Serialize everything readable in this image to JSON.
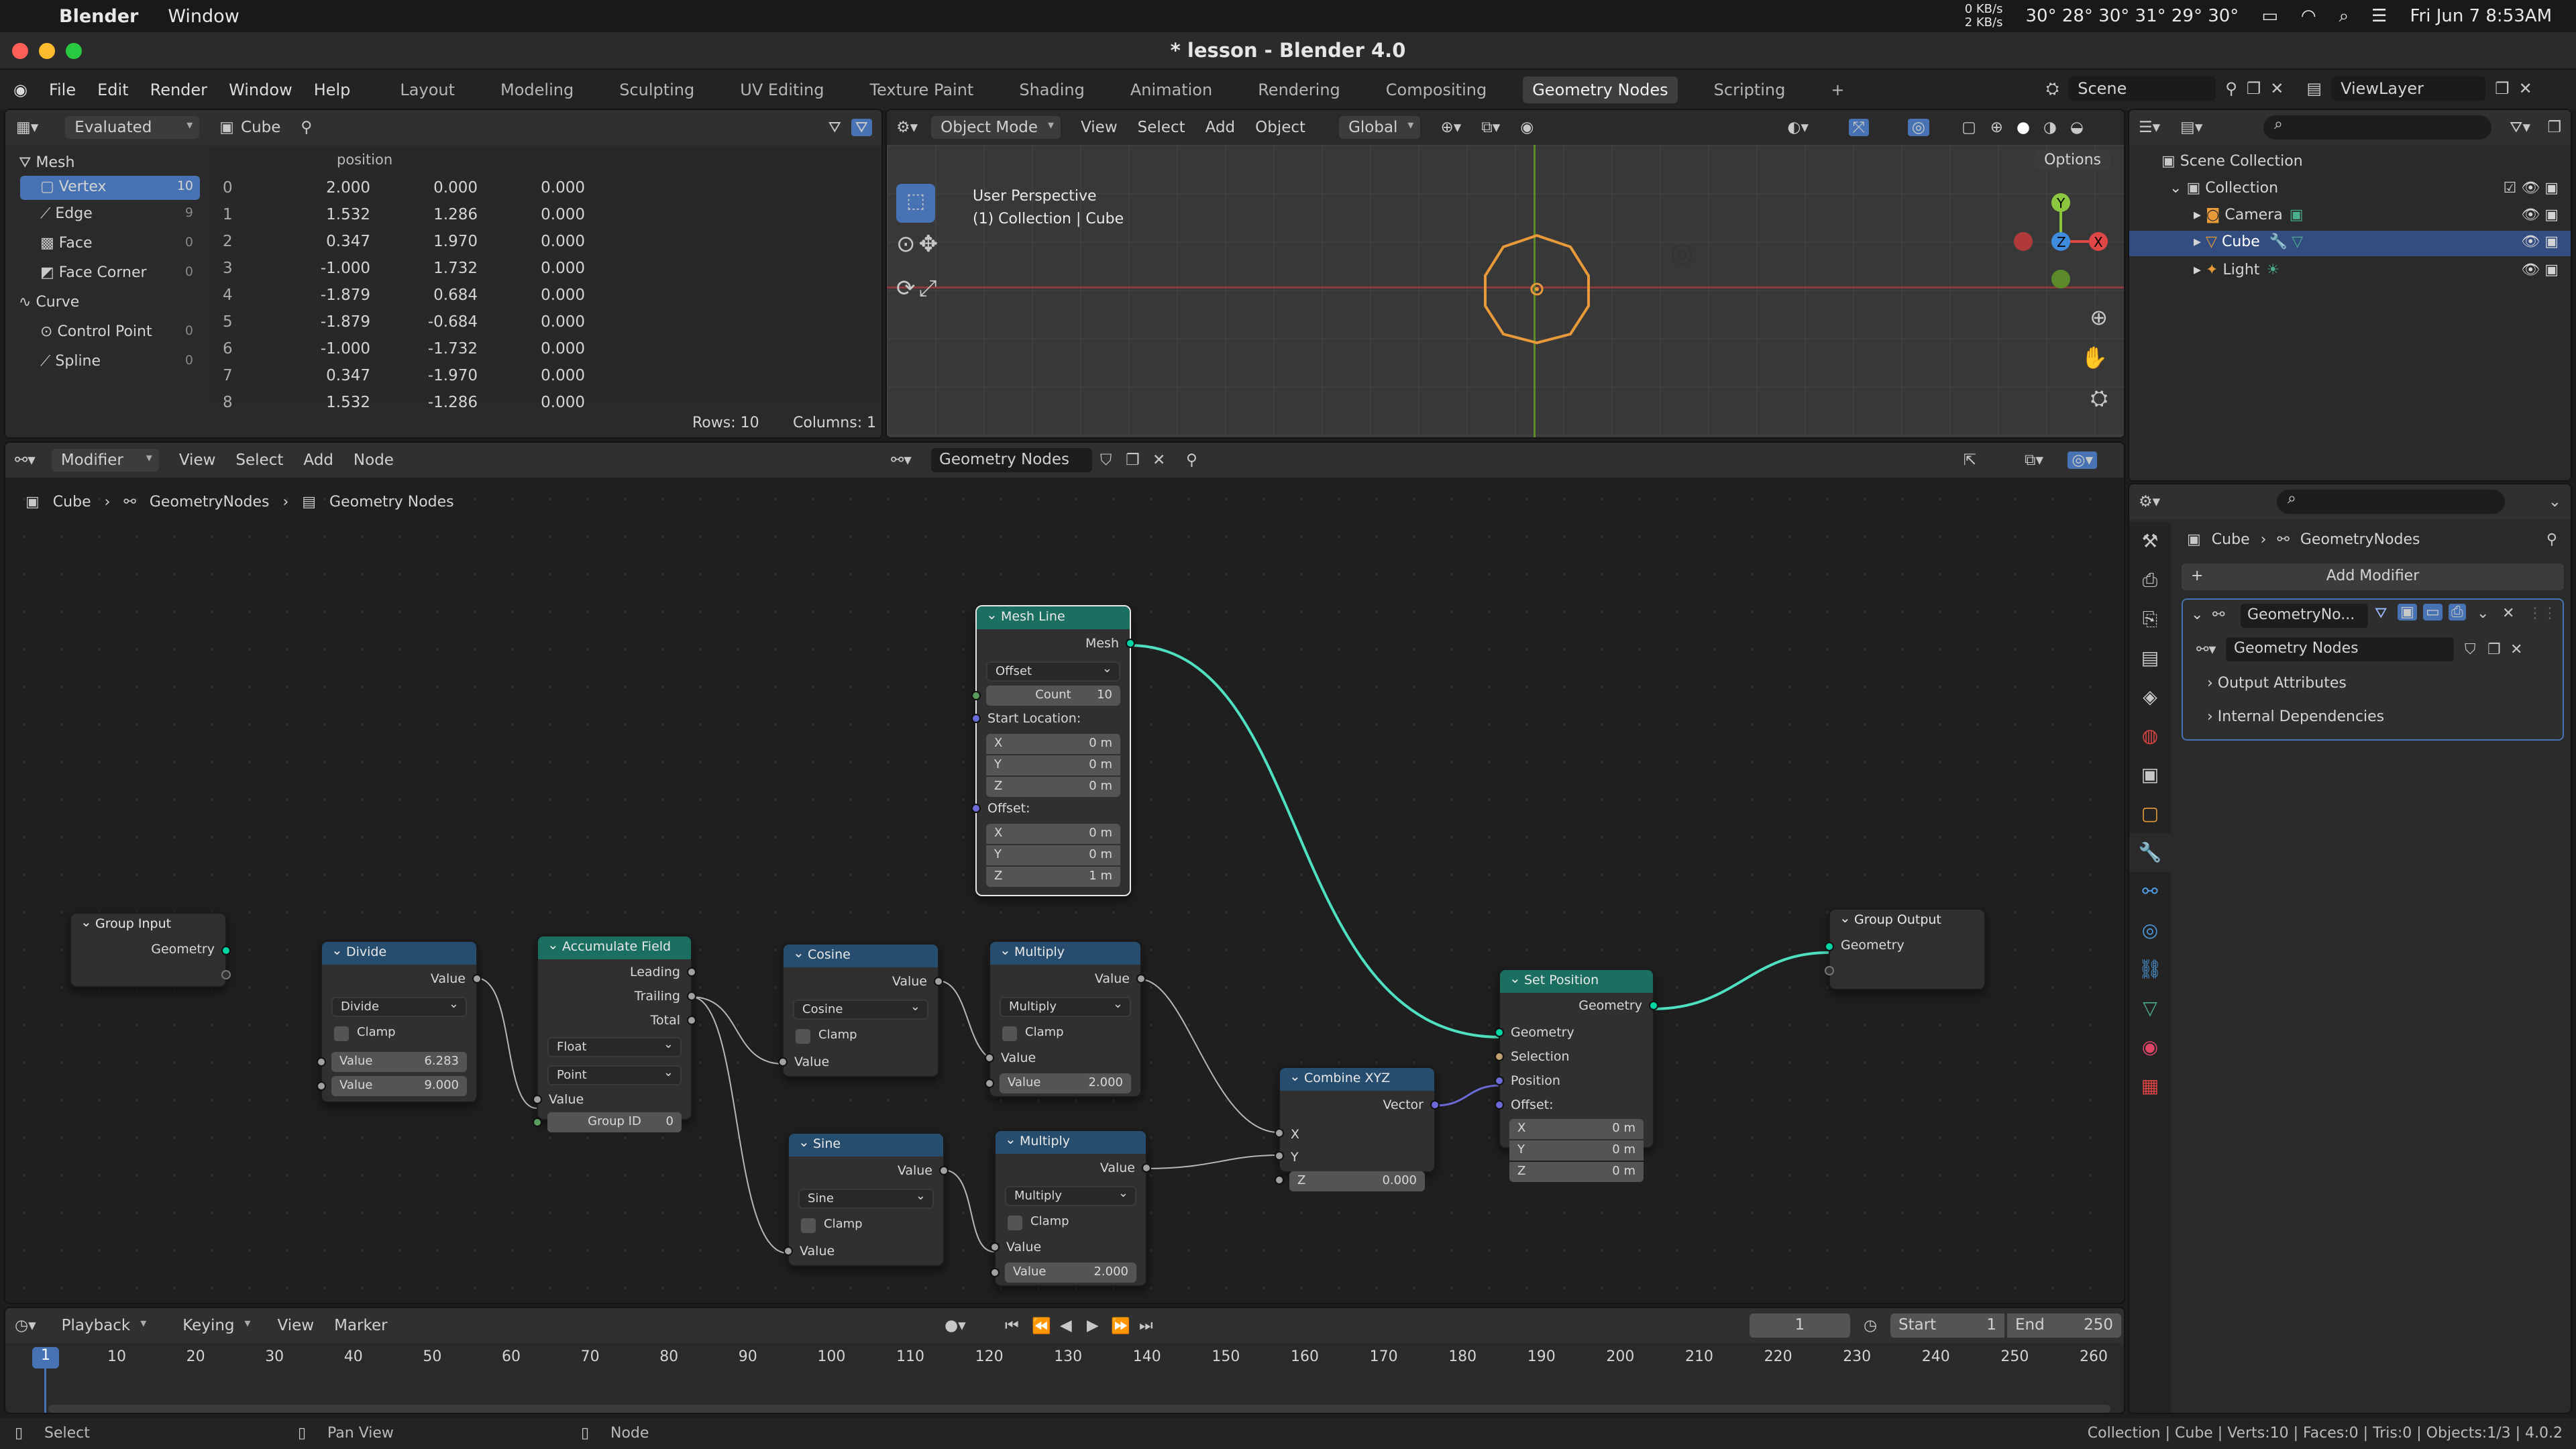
{
  "mac": {
    "app": "Blender",
    "window": "Window",
    "net_up": "0 KB/s",
    "net_down": "2 KB/s",
    "temps": "30° 28° 30° 31° 29° 30°",
    "datetime": "Fri Jun 7  8:53AM"
  },
  "title": "* lesson - Blender 4.0",
  "menus": [
    "File",
    "Edit",
    "Render",
    "Window",
    "Help"
  ],
  "workspaces": [
    "Layout",
    "Modeling",
    "Sculpting",
    "UV Editing",
    "Texture Paint",
    "Shading",
    "Animation",
    "Rendering",
    "Compositing",
    "Geometry Nodes",
    "Scripting"
  ],
  "active_workspace": "Geometry Nodes",
  "scene": "Scene",
  "view_layer": "ViewLayer",
  "spreadsheet": {
    "mode": "Evaluated",
    "object": "Cube",
    "column": "position",
    "tree": [
      {
        "label": "Mesh",
        "count": ""
      },
      {
        "label": "Vertex",
        "count": "10"
      },
      {
        "label": "Edge",
        "count": "9"
      },
      {
        "label": "Face",
        "count": "0"
      },
      {
        "label": "Face Corner",
        "count": "0"
      },
      {
        "label": "Curve",
        "count": ""
      },
      {
        "label": "Control Point",
        "count": "0"
      },
      {
        "label": "Spline",
        "count": "0"
      }
    ],
    "rows": [
      [
        "0",
        "2.000",
        "0.000",
        "0.000"
      ],
      [
        "1",
        "1.532",
        "1.286",
        "0.000"
      ],
      [
        "2",
        "0.347",
        "1.970",
        "0.000"
      ],
      [
        "3",
        "-1.000",
        "1.732",
        "0.000"
      ],
      [
        "4",
        "-1.879",
        "0.684",
        "0.000"
      ],
      [
        "5",
        "-1.879",
        "-0.684",
        "0.000"
      ],
      [
        "6",
        "-1.000",
        "-1.732",
        "0.000"
      ],
      [
        "7",
        "0.347",
        "-1.970",
        "0.000"
      ],
      [
        "8",
        "1.532",
        "-1.286",
        "0.000"
      ]
    ],
    "rows_label": "Rows: 10",
    "cols_label": "Columns: 1"
  },
  "viewport": {
    "mode": "Object Mode",
    "menus": [
      "View",
      "Select",
      "Add",
      "Object"
    ],
    "orient": "Global",
    "options": "Options",
    "persp": "User Perspective",
    "coll": "(1) Collection | Cube"
  },
  "outliner": {
    "items": [
      "Scene Collection",
      "Collection",
      "Camera",
      "Cube",
      "Light"
    ]
  },
  "node_editor": {
    "header": {
      "mode": "Modifier",
      "menus": [
        "View",
        "Select",
        "Add",
        "Node"
      ],
      "tree": "Geometry Nodes"
    },
    "breadcrumb": [
      "Cube",
      "GeometryNodes",
      "Geometry Nodes"
    ],
    "nodes": {
      "group_input": {
        "title": "Group Input",
        "out": "Geometry"
      },
      "divide": {
        "title": "Divide",
        "out": "Value",
        "op": "Divide",
        "clamp": "Clamp",
        "in_label": "Value",
        "v1": "6.283",
        "v2": "9.000"
      },
      "accum": {
        "title": "Accumulate Field",
        "o1": "Leading",
        "o2": "Trailing",
        "o3": "Total",
        "dtype": "Float",
        "domain": "Point",
        "in": "Value",
        "gid": "Group ID",
        "gid_v": "0"
      },
      "cosine": {
        "title": "Cosine",
        "out": "Value",
        "op": "Cosine",
        "clamp": "Clamp",
        "in": "Value"
      },
      "sine": {
        "title": "Sine",
        "out": "Value",
        "op": "Sine",
        "clamp": "Clamp",
        "in": "Value"
      },
      "mult1": {
        "title": "Multiply",
        "out": "Value",
        "op": "Multiply",
        "clamp": "Clamp",
        "in": "Value",
        "v": "2.000"
      },
      "mult2": {
        "title": "Multiply",
        "out": "Value",
        "op": "Multiply",
        "clamp": "Clamp",
        "in": "Value",
        "v": "2.000"
      },
      "meshline": {
        "title": "Mesh Line",
        "out": "Mesh",
        "mode": "Offset",
        "count_l": "Count",
        "count": "10",
        "start": "Start Location:",
        "offset": "Offset:",
        "sx": "0 m",
        "sy": "0 m",
        "sz": "0 m",
        "ox": "0 m",
        "oy": "0 m",
        "oz": "1 m"
      },
      "combine": {
        "title": "Combine XYZ",
        "out": "Vector",
        "x": "X",
        "y": "Y",
        "z": "Z",
        "zv": "0.000"
      },
      "setpos": {
        "title": "Set Position",
        "out": "Geometry",
        "i1": "Geometry",
        "i2": "Selection",
        "i3": "Position",
        "i4": "Offset:",
        "x": "0 m",
        "y": "0 m",
        "z": "0 m"
      },
      "group_output": {
        "title": "Group Output",
        "in": "Geometry"
      }
    }
  },
  "properties": {
    "breadcrumb": [
      "Cube",
      "GeometryNodes"
    ],
    "add_modifier": "Add Modifier",
    "mod_name": "GeometryNo...",
    "tree": "Geometry Nodes",
    "p1": "Output Attributes",
    "p2": "Internal Dependencies"
  },
  "timeline": {
    "menus": [
      "Playback",
      "Keying",
      "View",
      "Marker"
    ],
    "frame": "1",
    "start_l": "Start",
    "start": "1",
    "end_l": "End",
    "end": "250",
    "ticks": [
      "10",
      "20",
      "30",
      "40",
      "50",
      "60",
      "70",
      "80",
      "90",
      "100",
      "110",
      "120",
      "130",
      "140",
      "150",
      "160",
      "170",
      "180",
      "190",
      "200",
      "210",
      "220",
      "230",
      "240",
      "250",
      "260"
    ],
    "cur": "1"
  },
  "status": {
    "select": "Select",
    "pan": "Pan View",
    "node": "Node",
    "info": "Collection | Cube | Verts:10 | Faces:0 | Tris:0 | Objects:1/3 | 4.0.2"
  }
}
